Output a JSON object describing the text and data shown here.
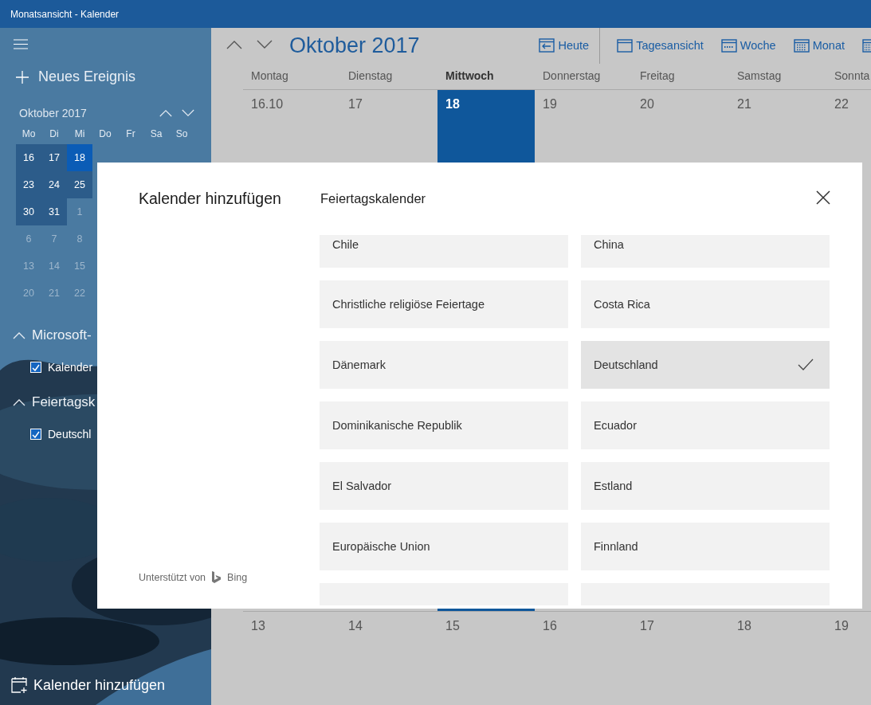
{
  "window": {
    "title": "Monatsansicht - Kalender"
  },
  "sidebar": {
    "new_event": "Neues Ereignis",
    "mini_calendar": {
      "title": "Oktober 2017",
      "weekdays": [
        "Mo",
        "Di",
        "Mi",
        "Do",
        "Fr",
        "Sa",
        "So"
      ],
      "weeks": [
        [
          {
            "day": "16",
            "in_view": true,
            "today": false
          },
          {
            "day": "17",
            "in_view": true,
            "today": false
          },
          {
            "day": "18",
            "in_view": true,
            "today": true
          }
        ],
        [
          {
            "day": "23",
            "in_view": true,
            "today": false
          },
          {
            "day": "24",
            "in_view": true,
            "today": false
          },
          {
            "day": "25",
            "in_view": true,
            "today": false
          }
        ],
        [
          {
            "day": "30",
            "in_view": true,
            "today": false
          },
          {
            "day": "31",
            "in_view": true,
            "today": false
          },
          {
            "day": "1",
            "in_view": false,
            "today": false
          }
        ],
        [
          {
            "day": "6",
            "in_view": false,
            "today": false
          },
          {
            "day": "7",
            "in_view": false,
            "today": false
          },
          {
            "day": "8",
            "in_view": false,
            "today": false
          }
        ],
        [
          {
            "day": "13",
            "in_view": false,
            "today": false
          },
          {
            "day": "14",
            "in_view": false,
            "today": false
          },
          {
            "day": "15",
            "in_view": false,
            "today": false
          }
        ],
        [
          {
            "day": "20",
            "in_view": false,
            "today": false
          },
          {
            "day": "21",
            "in_view": false,
            "today": false
          },
          {
            "day": "22",
            "in_view": false,
            "today": false
          }
        ]
      ]
    },
    "groups": [
      {
        "title": "Microsoft-",
        "expanded": true,
        "calendars": [
          {
            "label": "Kalender",
            "checked": true
          }
        ]
      },
      {
        "title": "Feiertagsk",
        "expanded": true,
        "calendars": [
          {
            "label": "Deutschl",
            "checked": true
          }
        ]
      }
    ],
    "add_calendar": "Kalender hinzufügen"
  },
  "toolbar": {
    "month": "Oktober 2017",
    "today": "Heute",
    "views": [
      {
        "label": "Tagesansicht",
        "kind": "day"
      },
      {
        "label": "Woche",
        "kind": "week"
      },
      {
        "label": "Monat",
        "kind": "month"
      },
      {
        "kind": "year"
      }
    ]
  },
  "month_view": {
    "weekdays": [
      {
        "label": "Montag",
        "today": false
      },
      {
        "label": "Dienstag",
        "today": false
      },
      {
        "label": "Mittwoch",
        "today": true
      },
      {
        "label": "Donnerstag",
        "today": false
      },
      {
        "label": "Freitag",
        "today": false
      },
      {
        "label": "Samstag",
        "today": false
      },
      {
        "label": "Sonnta",
        "today": false
      }
    ],
    "first_week": [
      {
        "day": "16.10",
        "today": false
      },
      {
        "day": "17",
        "today": false
      },
      {
        "day": "18",
        "today": true
      },
      {
        "day": "19",
        "today": false
      },
      {
        "day": "20",
        "today": false
      },
      {
        "day": "21",
        "today": false
      },
      {
        "day": "22",
        "today": false
      }
    ],
    "last_week": [
      "13",
      "14",
      "15",
      "16",
      "17",
      "18",
      "19"
    ]
  },
  "dialog": {
    "title": "Kalender hinzufügen",
    "powered_by": "Unterstützt von",
    "provider": "Bing",
    "list_title": "Feiertagskalender",
    "calendars": [
      {
        "label": "Chile",
        "selected": false
      },
      {
        "label": "China",
        "selected": false
      },
      {
        "label": "Christliche religiöse Feiertage",
        "selected": false
      },
      {
        "label": "Costa Rica",
        "selected": false
      },
      {
        "label": "Dänemark",
        "selected": false
      },
      {
        "label": "Deutschland",
        "selected": true
      },
      {
        "label": "Dominikanische Republik",
        "selected": false
      },
      {
        "label": "Ecuador",
        "selected": false
      },
      {
        "label": "El Salvador",
        "selected": false
      },
      {
        "label": "Estland",
        "selected": false
      },
      {
        "label": "Europäische Union",
        "selected": false
      },
      {
        "label": "Finnland",
        "selected": false
      }
    ]
  }
}
